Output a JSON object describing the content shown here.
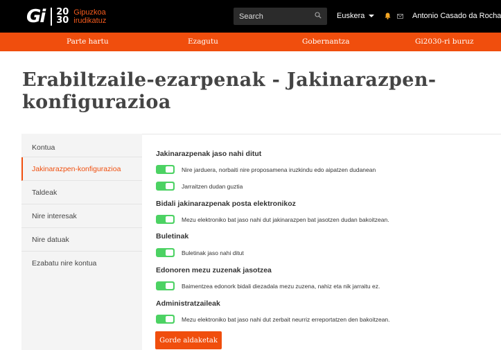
{
  "header": {
    "logo": {
      "mark": "Gi",
      "year_top": "20",
      "year_bottom": "30",
      "subtitle_line1": "Gipuzkoa",
      "subtitle_line2": "irudikatuz"
    },
    "search": {
      "placeholder": "Search",
      "icon": "search-icon"
    },
    "language": "Euskera",
    "icons": [
      "bell-icon",
      "mail-icon"
    ],
    "user_name": "Antonio Casado da Rocha",
    "colors": {
      "background": "#000000",
      "accent": "#f04e0d",
      "bell": "#f5a623"
    }
  },
  "nav": {
    "items": [
      {
        "label": "Parte hartu"
      },
      {
        "label": "Ezagutu"
      },
      {
        "label": "Gobernantza"
      },
      {
        "label": "Gi2030-ri buruz"
      }
    ]
  },
  "page": {
    "title": "Erabiltzaile-ezarpenak - Jakinarazpen-konfigurazioa"
  },
  "sidebar": {
    "items": [
      {
        "label": "Kontua",
        "active": false
      },
      {
        "label": "Jakinarazpen-konfigurazioa",
        "active": true
      },
      {
        "label": "Taldeak",
        "active": false
      },
      {
        "label": "Nire interesak",
        "active": false
      },
      {
        "label": "Nire datuak",
        "active": false
      },
      {
        "label": "Ezabatu nire kontua",
        "active": false
      }
    ]
  },
  "sections": [
    {
      "title": "Jakinarazpenak jaso nahi ditut",
      "prefs": [
        {
          "label": "Nire jarduera, norbaiti nire proposamena iruzkindu edo aipatzen dudanean",
          "enabled": true
        },
        {
          "label": "Jarraitzen dudan guztia",
          "enabled": true
        }
      ]
    },
    {
      "title": "Bidali jakinarazpenak posta elektronikoz",
      "prefs": [
        {
          "label": "Mezu elektroniko bat jaso nahi dut jakinarazpen bat jasotzen dudan bakoitzean.",
          "enabled": true
        }
      ]
    },
    {
      "title": "Buletinak",
      "prefs": [
        {
          "label": "Buletinak jaso nahi ditut",
          "enabled": true
        }
      ]
    },
    {
      "title": "Edonoren mezu zuzenak jasotzea",
      "prefs": [
        {
          "label": "Baimentzea edonork bidali diezadala mezu zuzena, nahiz eta nik jarraitu ez.",
          "enabled": true
        }
      ]
    },
    {
      "title": "Administratzaileak",
      "prefs": [
        {
          "label": "Mezu elektroniko bat jaso nahi dut zerbait neurriz erreportatzen den bakoitzean.",
          "enabled": true
        }
      ]
    }
  ],
  "actions": {
    "save_label": "Gorde aldaketak"
  },
  "colors": {
    "toggle_on": "#4cd263",
    "accent": "#f04e0d",
    "sidebar_bg": "#f4f4f4"
  }
}
